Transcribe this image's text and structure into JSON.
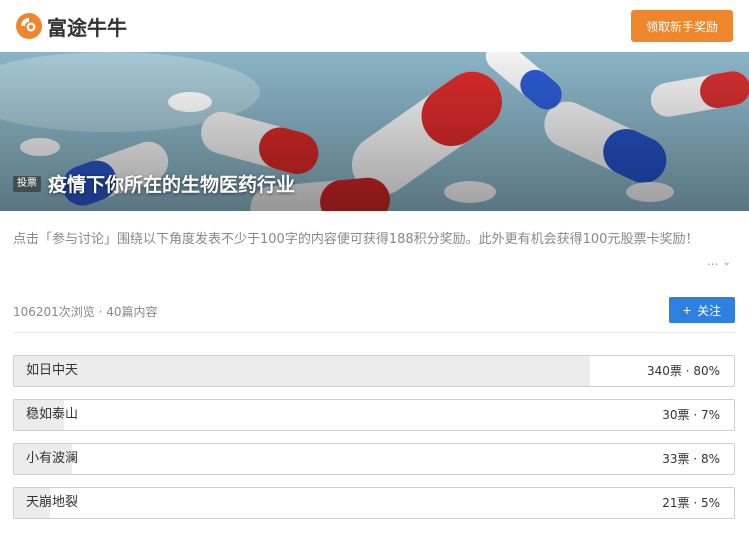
{
  "header": {
    "logo_text": "富途牛牛",
    "logo_icon": "futu-logo-icon",
    "reward_button": "领取新手奖励",
    "reward_color": "#f0862c"
  },
  "banner": {
    "tag": "投票",
    "title": "疫情下你所在的生物医药行业"
  },
  "description": {
    "text": "点击「参与讨论」围绕以下角度发表不少于100字的内容便可获得188积分奖励。此外更有机会获得100元股票卡奖励！",
    "more": "...",
    "more_icon": "chevron-down-icon"
  },
  "stats": {
    "text": "106201次浏览 · 40篇内容"
  },
  "follow": {
    "label": "关注",
    "icon": "plus-icon",
    "color": "#2e7fe0"
  },
  "poll": {
    "options": [
      {
        "label": "如日中天",
        "result": "340票 · 80%",
        "fraction": 0.8
      },
      {
        "label": "稳如泰山",
        "result": "30票 · 7%",
        "fraction": 0.07
      },
      {
        "label": "小有波澜",
        "result": "33票 · 8%",
        "fraction": 0.08
      },
      {
        "label": "天崩地裂",
        "result": "21票 · 5%",
        "fraction": 0.05
      }
    ]
  }
}
